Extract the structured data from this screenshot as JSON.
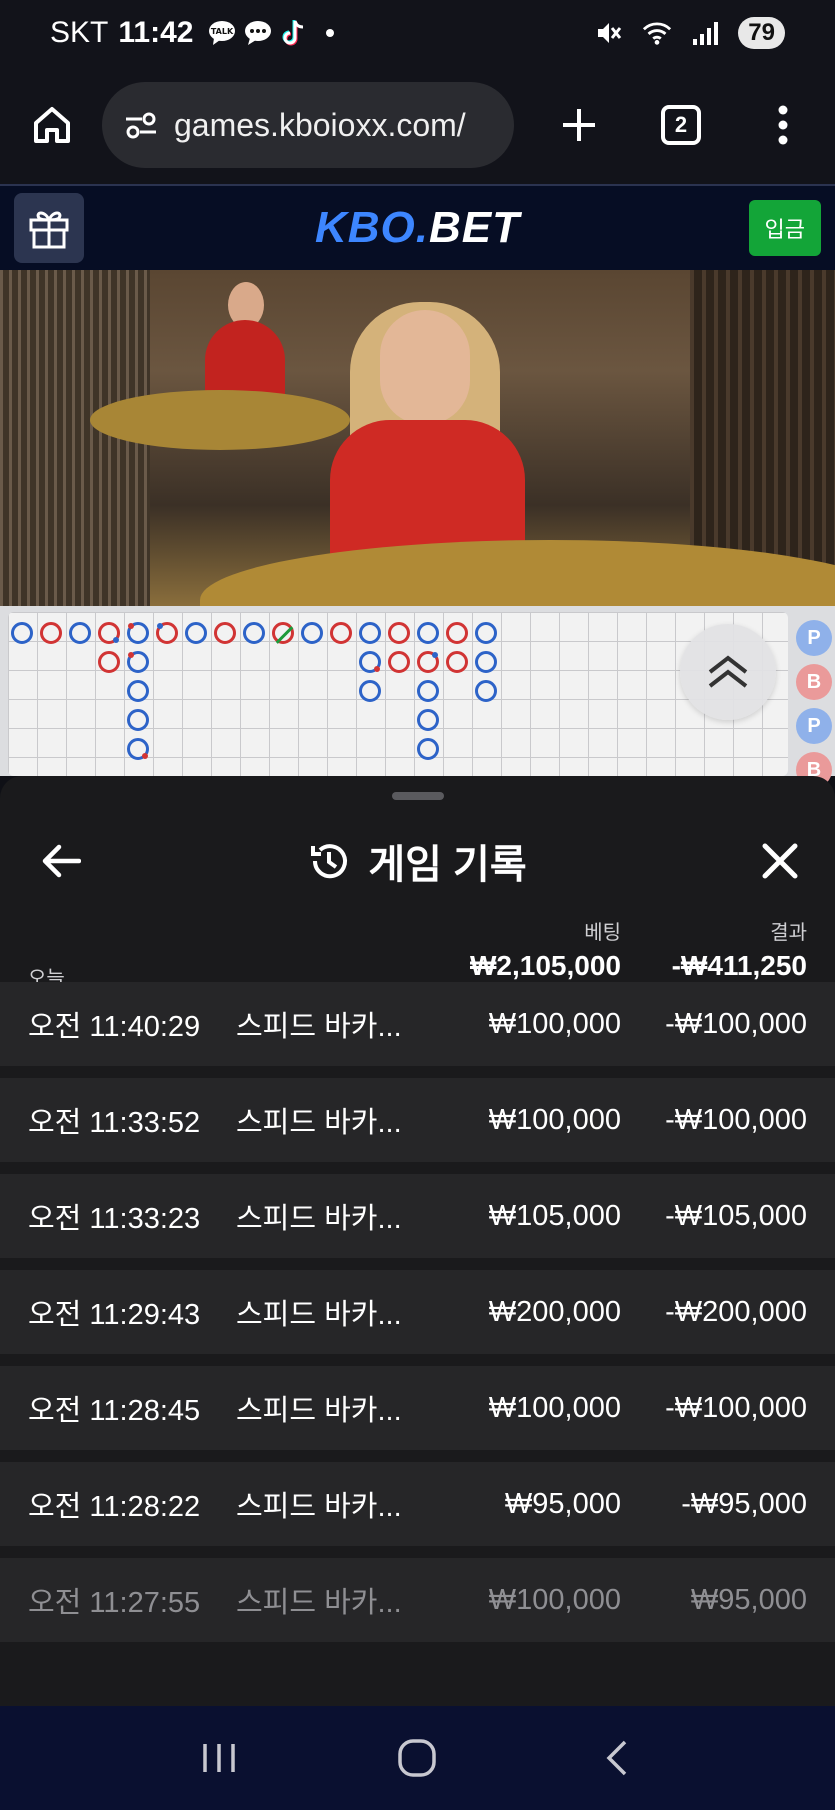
{
  "status_bar": {
    "carrier": "SKT",
    "time": "11:42",
    "battery": "79",
    "icons": [
      "talk-icon",
      "message-icon",
      "tiktok-icon",
      "mute-icon",
      "wifi-icon",
      "signal-icon"
    ]
  },
  "browser": {
    "url": "games.kboioxx.com/",
    "tab_count": "2"
  },
  "site": {
    "logo_part1": "KBO.",
    "logo_part2": "BET",
    "deposit_label": "입금",
    "brand_color": "#3d86ff",
    "deposit_color": "#13a538"
  },
  "roadmap": {
    "side_badges": [
      "P",
      "B",
      "P",
      "B"
    ]
  },
  "sheet": {
    "title": "게임 기록",
    "bet_col_label": "베팅",
    "result_col_label": "결과",
    "today_label": "오늘",
    "today_bet_total": "₩2,105,000",
    "today_result_total": "-₩411,250",
    "rows": [
      {
        "time": "오전 11:40:29",
        "game": "스피드 바카...",
        "bet": "₩100,000",
        "result": "-₩100,000"
      },
      {
        "time": "오전 11:33:52",
        "game": "스피드 바카...",
        "bet": "₩100,000",
        "result": "-₩100,000"
      },
      {
        "time": "오전 11:33:23",
        "game": "스피드 바카...",
        "bet": "₩105,000",
        "result": "-₩105,000"
      },
      {
        "time": "오전 11:29:43",
        "game": "스피드 바카...",
        "bet": "₩200,000",
        "result": "-₩200,000"
      },
      {
        "time": "오전 11:28:45",
        "game": "스피드 바카...",
        "bet": "₩100,000",
        "result": "-₩100,000"
      },
      {
        "time": "오전 11:28:22",
        "game": "스피드 바카...",
        "bet": "₩95,000",
        "result": "-₩95,000"
      },
      {
        "time": "오전 11:27:55",
        "game": "스피드 바카...",
        "bet": "₩100,000",
        "result": "₩95,000"
      }
    ]
  }
}
